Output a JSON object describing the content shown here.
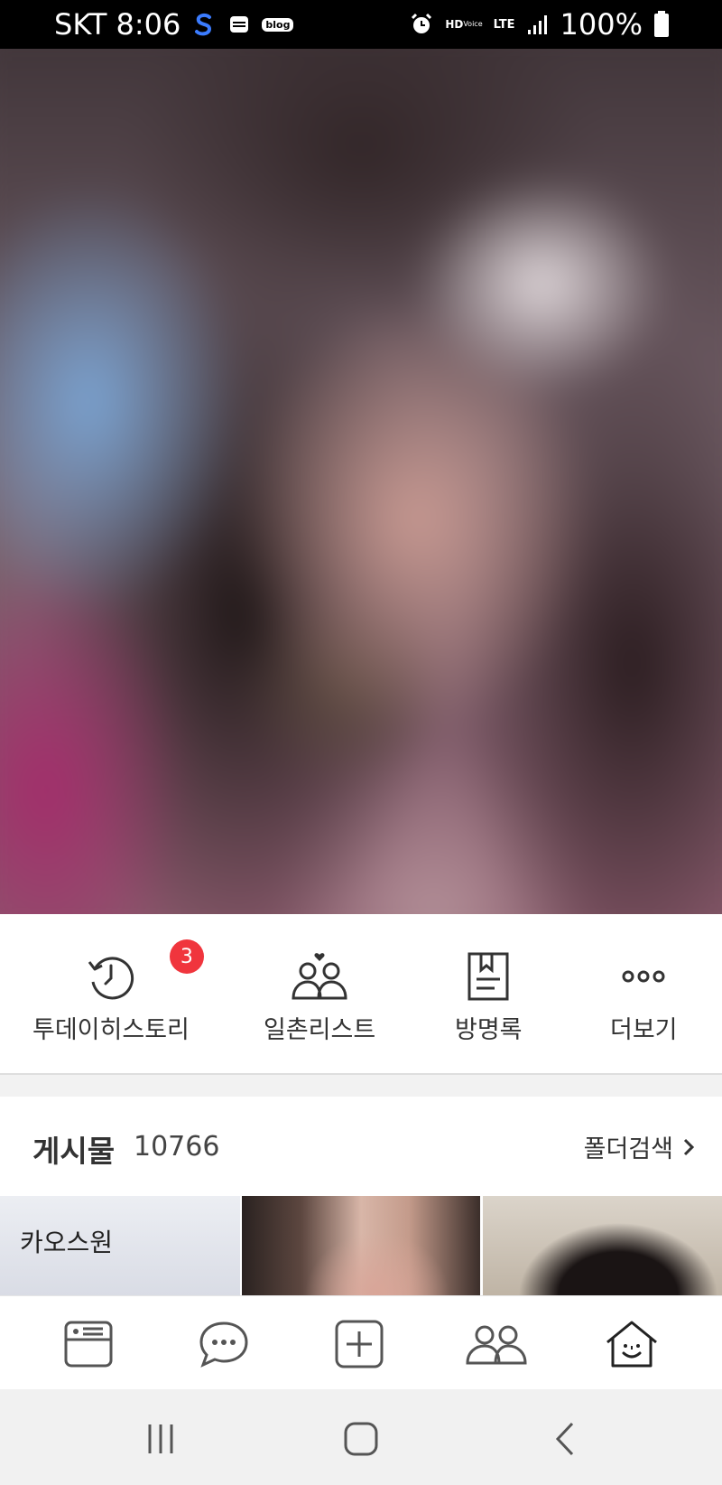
{
  "status_bar": {
    "carrier_time": "SKT 8:06",
    "blog_badge": "blog",
    "hd_voice": "HD",
    "hd_voice_sub": "Voice",
    "network": "LTE",
    "battery": "100%"
  },
  "quick_menu": [
    {
      "label": "투데이히스토리",
      "icon": "history-clock-icon",
      "badge": "3"
    },
    {
      "label": "일촌리스트",
      "icon": "friends-heart-icon"
    },
    {
      "label": "방명록",
      "icon": "guestbook-icon"
    },
    {
      "label": "더보기",
      "icon": "more-dots-icon"
    }
  ],
  "posts": {
    "title": "게시물",
    "count": "10766",
    "folder_search": "폴더검색"
  },
  "grid": {
    "first_tile_label": "카오스원"
  },
  "bottom_nav": [
    "feed-icon",
    "chat-icon",
    "add-post-icon",
    "friends-icon",
    "minihome-icon"
  ],
  "colors": {
    "badge": "#f0353d",
    "text": "#333333"
  }
}
